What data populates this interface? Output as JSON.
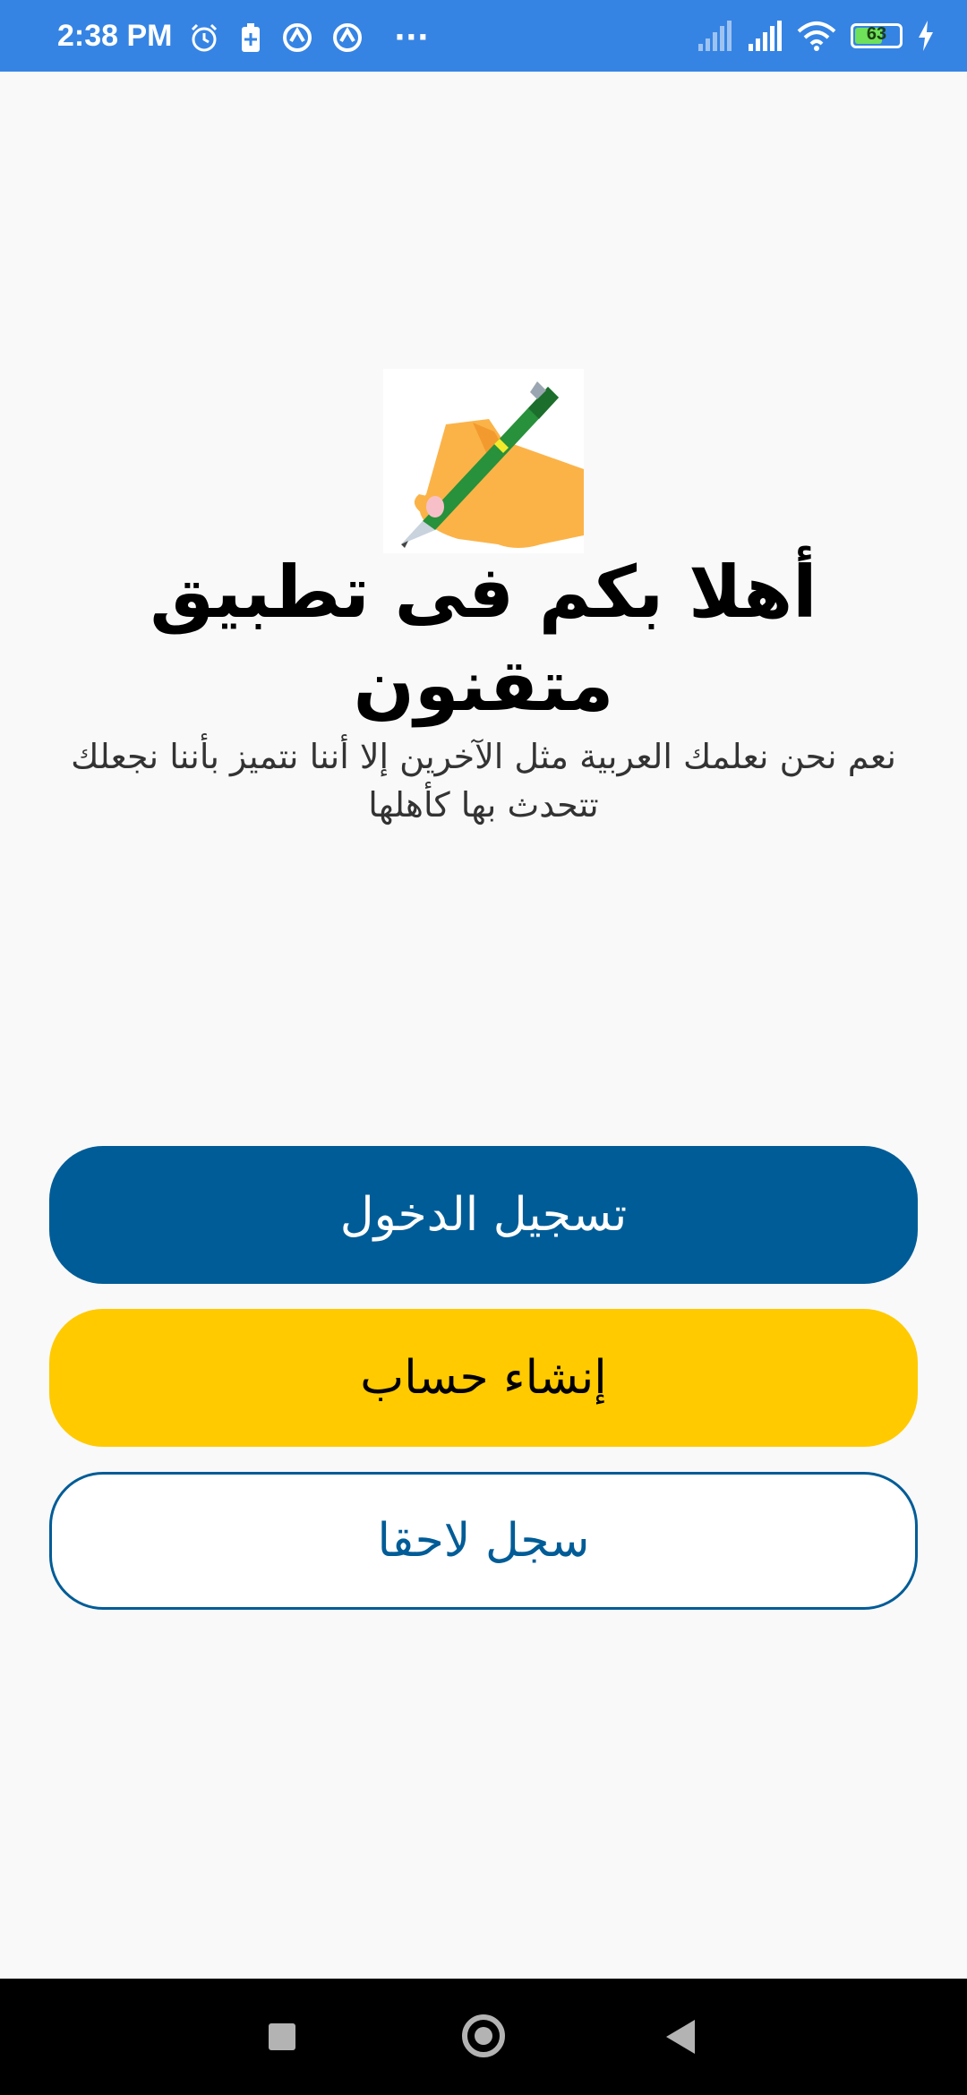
{
  "status_bar": {
    "time": "2:38 PM",
    "battery_level": "63",
    "battery_fraction": 0.63,
    "left_icons": [
      "alarm-icon",
      "battery-saver-icon",
      "sync-icon",
      "sync-icon",
      "more-dots-icon"
    ],
    "right_icons": [
      "signal-icon",
      "signal-icon",
      "wifi-icon",
      "battery-icon",
      "charging-icon"
    ],
    "more_dots": "···"
  },
  "welcome": {
    "logo_icon": "hand-writing-pen-icon",
    "title": "أهلا بكم فى تطبيق متقنون",
    "subtitle": "نعم نحن نعلمك العربية مثل الآخرين إلا أننا نتميز بأننا نجعلك تتحدث بها كأهلها"
  },
  "buttons": {
    "login": "تسجيل الدخول",
    "register": "إنشاء حساب",
    "later": "سجل لاحقا"
  },
  "colors": {
    "status_bar": "#3584e4",
    "primary": "#005c97",
    "accent": "#ffca00",
    "background": "#f9f9f9"
  },
  "nav_bar": {
    "icons": [
      "recent-apps-icon",
      "home-icon",
      "back-icon"
    ]
  }
}
